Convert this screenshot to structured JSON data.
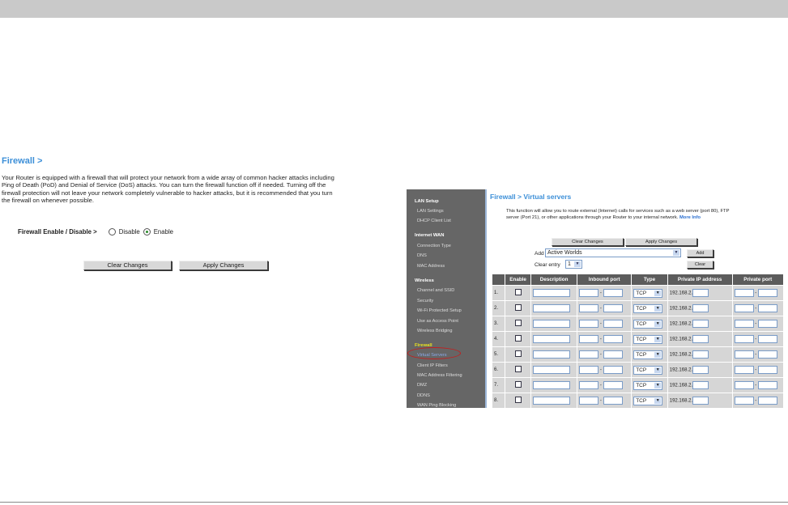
{
  "firewall": {
    "title": "Firewall >",
    "description": "Your Router is equipped with a firewall that will protect your network from a wide array of common hacker attacks including Ping of Death (PoD) and Denial of Service (DoS) attacks. You can turn the firewall function off if needed. Turning off the firewall protection will not leave your network completely vulnerable to hacker attacks, but it is recommended that you turn the firewall on whenever possible.",
    "toggle_label": "Firewall Enable / Disable >",
    "disable_label": "Disable",
    "enable_label": "Enable",
    "selected": "Enable",
    "clear_button": "Clear Changes",
    "apply_button": "Apply Changes"
  },
  "sidebar": {
    "sections": [
      {
        "heading": "LAN Setup",
        "items": [
          "LAN Settings",
          "DHCP Client List"
        ]
      },
      {
        "heading": "Internet WAN",
        "items": [
          "Connection Type",
          "DNS",
          "MAC Address"
        ]
      },
      {
        "heading": "Wireless",
        "items": [
          "Channel and SSID",
          "Security",
          "Wi-Fi Protected Setup",
          "Use as Access Point",
          "Wireless Bridging"
        ]
      },
      {
        "heading": "Firewall",
        "items": [
          "Virtual Servers",
          "Client IP Filters",
          "MAC Address Filtering",
          "DMZ",
          "DDNS",
          "WAN Ping Blocking"
        ]
      }
    ],
    "active": "Virtual Servers"
  },
  "virtual_servers": {
    "title": "Firewall > Virtual servers",
    "description": "This function will allow you to route external (Internet) calls for services such as a web server (port 80), FTP server (Port 21), or other applications through your Router to your internal network.",
    "more_info": "More Info",
    "clear_button": "Clear Changes",
    "apply_button": "Apply Changes",
    "add_label": "Add",
    "add_value": "Active Worlds",
    "add_button": "Add",
    "clear_entry_label": "Clear entry",
    "clear_entry_value": "1",
    "clear_button_small": "Clear",
    "columns": [
      "",
      "Enable",
      "Description",
      "Inbound port",
      "Type",
      "Private IP address",
      "Private port"
    ],
    "rows": [
      {
        "num": "1.",
        "type": "TCP",
        "ip_prefix": "192.168.2."
      },
      {
        "num": "2.",
        "type": "TCP",
        "ip_prefix": "192.168.2."
      },
      {
        "num": "3.",
        "type": "TCP",
        "ip_prefix": "192.168.2."
      },
      {
        "num": "4.",
        "type": "TCP",
        "ip_prefix": "192.168.2."
      },
      {
        "num": "5.",
        "type": "TCP",
        "ip_prefix": "192.168.2."
      },
      {
        "num": "6.",
        "type": "TCP",
        "ip_prefix": "192.168.2."
      },
      {
        "num": "7.",
        "type": "TCP",
        "ip_prefix": "192.168.2."
      },
      {
        "num": "8.",
        "type": "TCP",
        "ip_prefix": "192.168.2."
      }
    ]
  }
}
